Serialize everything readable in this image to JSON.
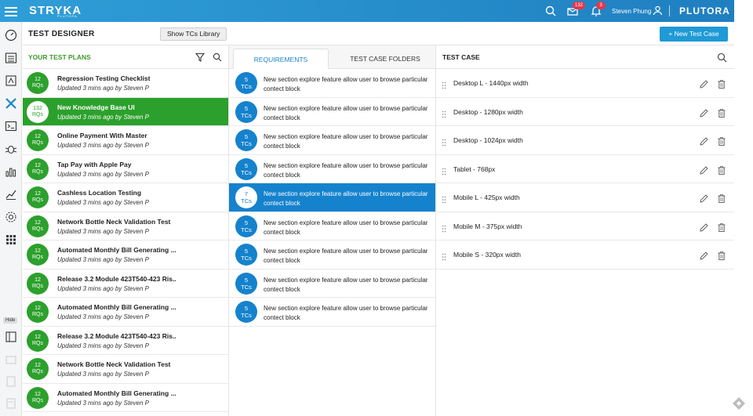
{
  "topbar": {
    "brand": "STRYKA",
    "brand_sub": "PLUTORA",
    "mail_count": "132",
    "notif_count": "3",
    "username": "Steven Phung",
    "company": "PLUTORA"
  },
  "sidebar": {
    "hide_label": "Hide",
    "icons": [
      "dashboard-icon",
      "list-icon",
      "release-icon",
      "tools-icon",
      "terminal-icon",
      "bug-icon",
      "bar-chart-icon",
      "trend-chart-icon",
      "settings-icon",
      "apps-grid-icon"
    ]
  },
  "header": {
    "title": "TEST DESIGNER",
    "library_button": "Show TCs Library",
    "new_button": "+ New Test Case"
  },
  "plans": {
    "title": "YOUR TEST PLANS",
    "items": [
      {
        "count": "12",
        "unit": "RQs",
        "name": "Regression Testing Checklist",
        "sub": "Updated 3 mins ago by Steven P"
      },
      {
        "count": "132",
        "unit": "RQs",
        "name": "New Knowledge Base UI",
        "sub": "Updated 3 mins ago by Steven P"
      },
      {
        "count": "12",
        "unit": "RQs",
        "name": "Online Payment With Master",
        "sub": "Updated 3 mins ago by Steven P"
      },
      {
        "count": "12",
        "unit": "RQs",
        "name": "Tap Pay with Apple Pay",
        "sub": "Updated 3 mins ago by Steven P"
      },
      {
        "count": "12",
        "unit": "RQs",
        "name": "Cashless Location Testing",
        "sub": "Updated 3 mins ago by Steven P"
      },
      {
        "count": "12",
        "unit": "RQs",
        "name": "Network Bottle Neck Validation Test",
        "sub": "Updated 3 mins ago by Steven P"
      },
      {
        "count": "12",
        "unit": "RQs",
        "name": "Automated Monthly Bill Generating ...",
        "sub": "Updated 3 mins ago by Steven P"
      },
      {
        "count": "12",
        "unit": "RQs",
        "name": "Release 3.2 Module 423T540-423 Ris..",
        "sub": "Updated 3 mins ago by Steven P"
      },
      {
        "count": "12",
        "unit": "RQs",
        "name": "Automated Monthly Bill Generating ...",
        "sub": "Updated 3 mins ago by Steven P"
      },
      {
        "count": "12",
        "unit": "RQs",
        "name": "Release 3.2 Module 423T540-423 Ris..",
        "sub": "Updated 3 mins ago by Steven P"
      },
      {
        "count": "12",
        "unit": "RQs",
        "name": "Network Bottle Neck Validation Test",
        "sub": "Updated 3 mins ago by Steven P"
      },
      {
        "count": "12",
        "unit": "RQs",
        "name": "Automated Monthly Bill Generating ...",
        "sub": "Updated 3 mins ago by Steven P"
      }
    ]
  },
  "requirements": {
    "tab_active": "REQUIREMENTS",
    "tab_other": "TEST CASE FOLDERS",
    "items": [
      {
        "count": "5",
        "unit": "TCs",
        "text": "New section explore feature allow user to browse particular contect block"
      },
      {
        "count": "5",
        "unit": "TCs",
        "text": "New section explore feature allow user to browse particular contect block"
      },
      {
        "count": "5",
        "unit": "TCs",
        "text": "New section explore feature allow user to browse particular contect block"
      },
      {
        "count": "5",
        "unit": "TCs",
        "text": "New section explore feature allow user to browse particular contect block"
      },
      {
        "count": "7",
        "unit": "TCs",
        "text": "New section explore feature allow user to browse particular contect block"
      },
      {
        "count": "5",
        "unit": "TCs",
        "text": "New section explore feature allow user to browse particular contect block"
      },
      {
        "count": "5",
        "unit": "TCs",
        "text": "New section explore feature allow user to browse particular contect block"
      },
      {
        "count": "5",
        "unit": "TCs",
        "text": "New section explore feature allow user to browse particular contect block"
      },
      {
        "count": "5",
        "unit": "TCs",
        "text": "New section explore feature allow user to browse particular contect block"
      }
    ]
  },
  "testcases": {
    "title": "TEST CASE",
    "items": [
      {
        "name": "Desktop L - 1440px width"
      },
      {
        "name": "Desktop - 1280px width"
      },
      {
        "name": "Desktop - 1024px width"
      },
      {
        "name": "Tablet - 768px"
      },
      {
        "name": "Mobile L - 425px width"
      },
      {
        "name": "Mobile M - 375px width"
      },
      {
        "name": "Mobile S - 320px width"
      }
    ]
  },
  "colors": {
    "topbar": "#1f8fd0",
    "plan_green": "#2ca02c",
    "req_blue": "#1582cd",
    "button_blue": "#1e9ad6",
    "badge_red": "#e6374d"
  }
}
